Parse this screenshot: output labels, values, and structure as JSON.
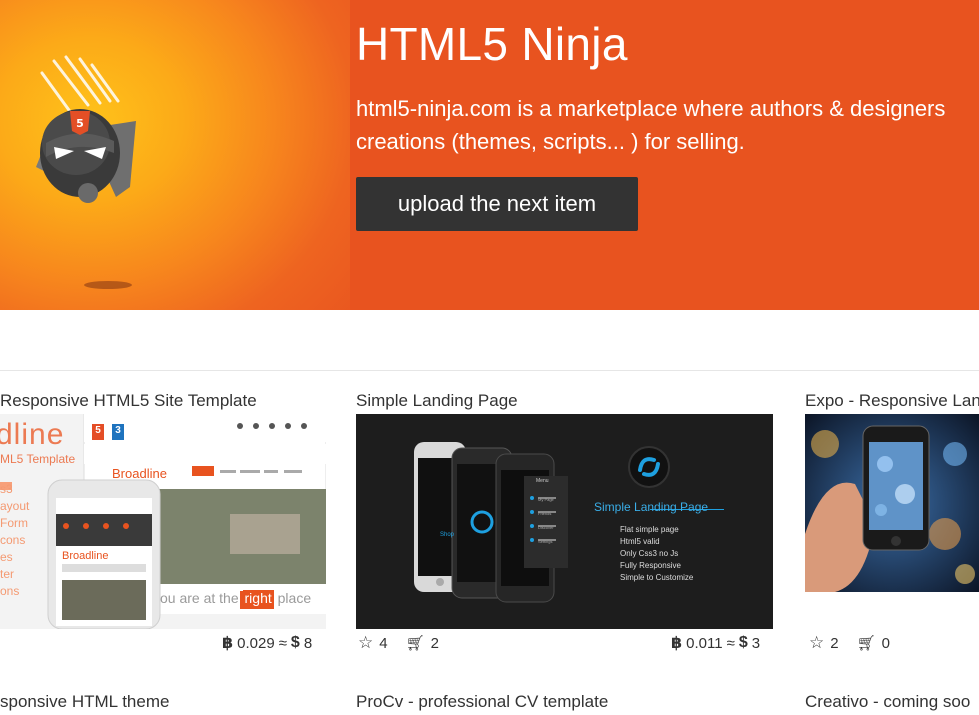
{
  "hero": {
    "title": "HTML5 Ninja",
    "description_line1": "html5-ninja.com is a marketplace where authors & designers",
    "description_line2": "creations (themes, scripts... ) for selling.",
    "upload_button": "upload the next item",
    "accent_color": "#e8531f"
  },
  "cards": [
    {
      "title": "Responsive HTML5 Site Template",
      "thumb": {
        "logo_text": "dline",
        "subtitle": "ML5 Template",
        "nav_brand": "Broadline",
        "phone_brand": "Broadline",
        "left_list": [
          "s3",
          "ayout",
          "Form",
          "cons",
          "es",
          "ter",
          "ons"
        ],
        "badges": [
          "5",
          "3"
        ],
        "nav_items": [
          "HOME",
          "ABOUT",
          "PORTFOLIO",
          "PAGES",
          "CONTACT"
        ],
        "banner_text_before": "ou are at the",
        "banner_highlight": "right",
        "banner_text_after": "place"
      },
      "btc": "0.029",
      "approx": "≈",
      "usd": "8"
    },
    {
      "title": "Simple Landing Page",
      "thumb": {
        "heading": "Simple Landing Page",
        "features": [
          "Flat simple page",
          "Html5 valid",
          "Only Css3 no Js",
          "Fully Responsive",
          "Simple to Customize"
        ],
        "phone_label": "Shop",
        "menu_header": "Menu",
        "menu_items": [
          "My Page",
          "Friends",
          "Discover",
          "Settings"
        ]
      },
      "stars": "4",
      "carts": "2",
      "btc": "0.011",
      "approx": "≈",
      "usd": "3"
    },
    {
      "title": "Expo - Responsive Lan",
      "stars": "2",
      "carts": "0"
    }
  ],
  "row2": [
    {
      "title": "sponsive HTML theme"
    },
    {
      "title": "ProCv - professional CV template"
    },
    {
      "title": "Creativo - coming soo"
    }
  ],
  "icons": [
    "ninja-logo",
    "star-icon",
    "cart-icon",
    "bitcoin-icon",
    "dollar-icon"
  ]
}
